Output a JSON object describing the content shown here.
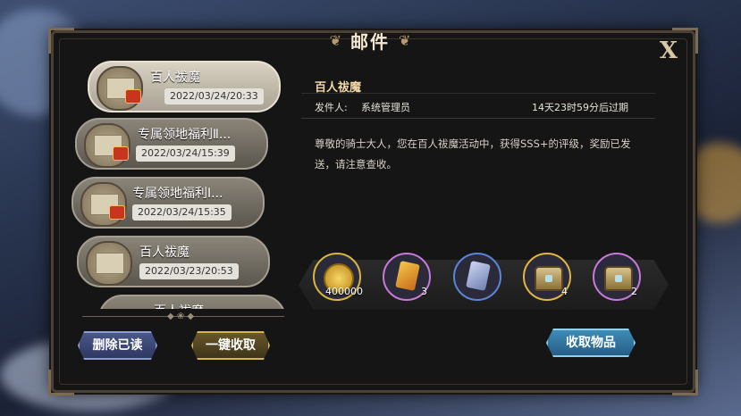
{
  "window": {
    "title": "邮件",
    "close_label": "X"
  },
  "mail_list": [
    {
      "title": "百人祓魔",
      "date": "2022/03/24/20:33",
      "active": true
    },
    {
      "title": "专属领地福利Ⅱ...",
      "date": "2022/03/24/15:39",
      "active": false
    },
    {
      "title": "专属领地福利Ⅰ...",
      "date": "2022/03/24/15:35",
      "active": false
    },
    {
      "title": "百人祓魔",
      "date": "2022/03/23/20:53",
      "active": false
    },
    {
      "title": "百人祓魔",
      "date": "",
      "active": false
    }
  ],
  "detail": {
    "title": "百人祓魔",
    "sender_label": "发件人:",
    "sender": "系统管理员",
    "expire": "14天23时59分后过期",
    "body": "尊敬的骑士大人，您在百人祓魔活动中，获得SSS+的评级，奖励已发送，请注意查收。"
  },
  "rewards": [
    {
      "icon": "gold-coin-icon",
      "count": "400000",
      "frame": "#d8b640"
    },
    {
      "icon": "gold-card-icon",
      "count": "3",
      "frame": "#c77ad8"
    },
    {
      "icon": "silver-card-icon",
      "count": "",
      "frame": "#5a86d8"
    },
    {
      "icon": "treasure-chest-icon",
      "count": "4",
      "frame": "#e3b73e"
    },
    {
      "icon": "treasure-chest-icon",
      "count": "2",
      "frame": "#c77ad8"
    }
  ],
  "buttons": {
    "delete_read": "删除已读",
    "collect_all": "一键收取",
    "collect": "收取物品"
  },
  "colors": {
    "panel": "#151515",
    "title_gold": "#f0d8a8",
    "accent_blue": "#3f8fb8"
  }
}
